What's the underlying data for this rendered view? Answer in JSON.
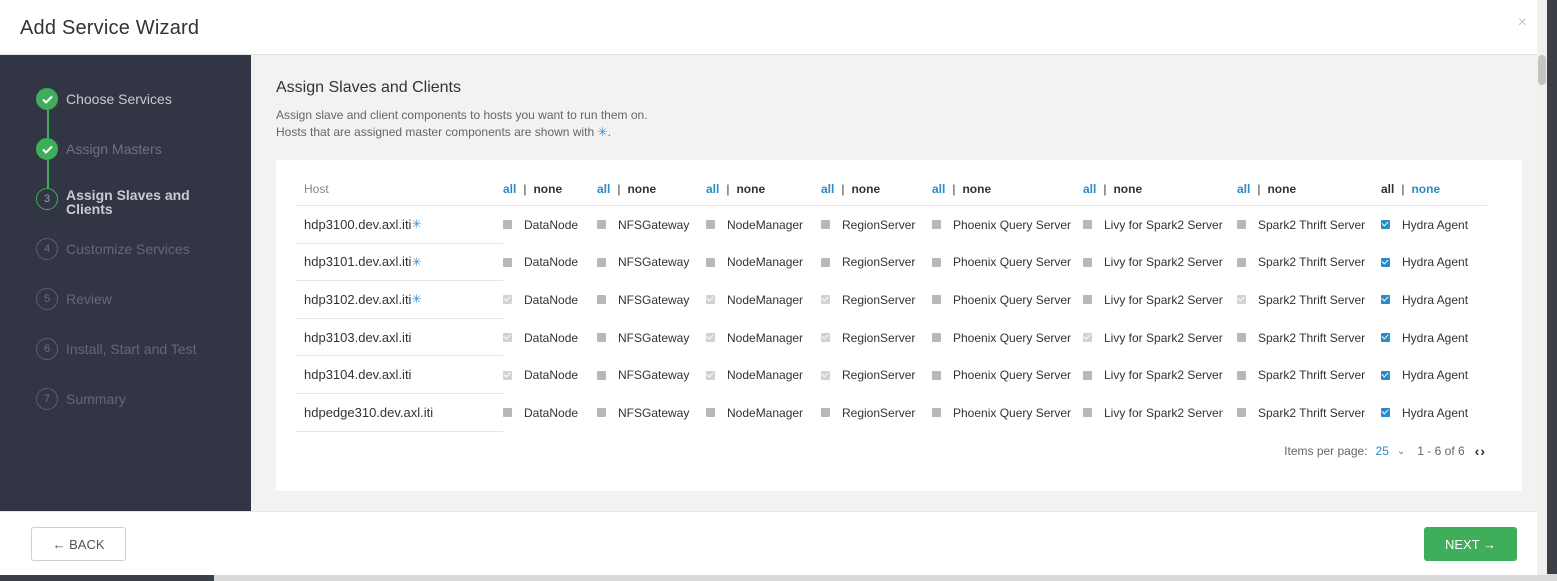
{
  "modal": {
    "title": "Add Service Wizard",
    "close": "×"
  },
  "sidebar": {
    "steps": [
      {
        "num": "",
        "label": "Choose Services",
        "state": "done"
      },
      {
        "num": "",
        "label": "Assign Masters",
        "state": "done-dim"
      },
      {
        "num": "3",
        "label": "Assign Slaves and Clients",
        "state": "active"
      },
      {
        "num": "4",
        "label": "Customize Services",
        "state": "pending"
      },
      {
        "num": "5",
        "label": "Review",
        "state": "pending"
      },
      {
        "num": "6",
        "label": "Install, Start and Test",
        "state": "pending"
      },
      {
        "num": "7",
        "label": "Summary",
        "state": "pending"
      }
    ]
  },
  "content": {
    "title": "Assign Slaves and Clients",
    "desc_line1": "Assign slave and client components to hosts you want to run them on.",
    "desc_line2": "Hosts that are assigned master components are shown with",
    "asterisk": "✳",
    "desc_end": "."
  },
  "table": {
    "host_header": "Host",
    "all_label": "all",
    "none_label": "none",
    "sep": "|",
    "components": [
      "DataNode",
      "NFSGateway",
      "NodeManager",
      "RegionServer",
      "Phoenix Query Server",
      "Livy for Spark2 Server",
      "Spark2 Thrift Server",
      "Hydra Agent"
    ],
    "rows": [
      {
        "host": "hdp3100.dev.axl.iti",
        "master": true,
        "checks": [
          "off",
          "off",
          "off",
          "off",
          "off",
          "off",
          "off",
          "blue"
        ]
      },
      {
        "host": "hdp3101.dev.axl.iti",
        "master": true,
        "checks": [
          "off",
          "off",
          "off",
          "off",
          "off",
          "off",
          "off",
          "blue"
        ]
      },
      {
        "host": "hdp3102.dev.axl.iti",
        "master": true,
        "checks": [
          "grey",
          "off",
          "grey",
          "grey",
          "off",
          "off",
          "grey",
          "blue"
        ]
      },
      {
        "host": "hdp3103.dev.axl.iti",
        "master": false,
        "checks": [
          "grey",
          "off",
          "grey",
          "grey",
          "off",
          "grey",
          "off",
          "blue"
        ]
      },
      {
        "host": "hdp3104.dev.axl.iti",
        "master": false,
        "checks": [
          "grey",
          "off",
          "grey",
          "grey",
          "off",
          "off",
          "off",
          "blue"
        ]
      },
      {
        "host": "hdpedge310.dev.axl.iti",
        "master": false,
        "checks": [
          "off",
          "off",
          "off",
          "off",
          "off",
          "off",
          "off",
          "blue"
        ]
      }
    ]
  },
  "pager": {
    "items_label": "Items per page:",
    "per_page": "25",
    "chevron": "⌄",
    "range": "1 - 6 of 6",
    "nav": "‹›"
  },
  "footer": {
    "back_label": "← BACK",
    "next_label": "NEXT →"
  },
  "colors": {
    "accent_green": "#3fae5b",
    "link_blue": "#2a8cc7",
    "sidebar_bg": "#323544"
  }
}
